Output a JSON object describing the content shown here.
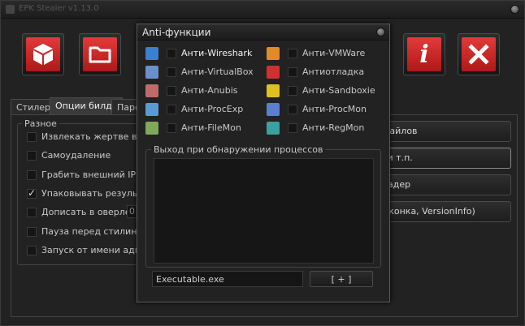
{
  "window": {
    "title": "EPK Stealer v1.13.0"
  },
  "toolbar": {
    "colors": {
      "face": "#d12a2a"
    },
    "buttons": [
      {
        "icon": "cube-icon"
      },
      {
        "icon": "folder-icon"
      },
      {
        "icon": "info-icon"
      },
      {
        "icon": "close-icon"
      }
    ]
  },
  "tabs": [
    {
      "label": "Стилер"
    },
    {
      "label": "Опции билда"
    },
    {
      "label": "Парсе"
    }
  ],
  "options": {
    "legend": "Разное",
    "items": [
      {
        "label": "Извлекать жертве в:",
        "checked": false
      },
      {
        "label": "Самоудаление",
        "checked": false
      },
      {
        "label": "Грабить внешний IP",
        "checked": false
      },
      {
        "label": "Упаковывать результа",
        "checked": true
      },
      {
        "label": "Дописать в оверлей",
        "checked": false
      },
      {
        "label": "Пауза перед стилингом",
        "checked": false
      },
      {
        "label": "Запуск от имени админ",
        "checked": false
      }
    ],
    "overlay_value": "0"
  },
  "right_buttons": [
    {
      "label": "файлов"
    },
    {
      "label": "l и т.п."
    },
    {
      "label": "радер"
    },
    {
      "label": "Иконка, VersionInfo)"
    }
  ],
  "dialog": {
    "title": "Anti-функции",
    "items_left": [
      {
        "label": "Анти-Wireshark",
        "icon": "wireshark-icon",
        "color": "#3a7fd0"
      },
      {
        "label": "Анти-VirtualBox",
        "icon": "virtualbox-icon",
        "color": "#6d8fc9"
      },
      {
        "label": "Анти-Anubis",
        "icon": "anubis-icon",
        "color": "#c06a6a"
      },
      {
        "label": "Анти-ProcExp",
        "icon": "procexp-icon",
        "color": "#5c9ad6"
      },
      {
        "label": "Анти-FileMon",
        "icon": "filemon-icon",
        "color": "#7fa85a"
      }
    ],
    "items_right": [
      {
        "label": "Анти-VMWare",
        "icon": "vmware-icon",
        "color": "#e08a2a"
      },
      {
        "label": "Антиотладка",
        "icon": "bug-icon",
        "color": "#d03030"
      },
      {
        "label": "Анти-Sandboxie",
        "icon": "sandboxie-icon",
        "color": "#e0c020"
      },
      {
        "label": "Анти-ProcMon",
        "icon": "procmon-icon",
        "color": "#5a7fd0"
      },
      {
        "label": "Анти-RegMon",
        "icon": "regmon-icon",
        "color": "#3aa0a0"
      }
    ],
    "process_group_label": "Выход при обнаружении процессов",
    "exe_input_value": "Executable.exe",
    "add_button_label": "[ + ]"
  }
}
